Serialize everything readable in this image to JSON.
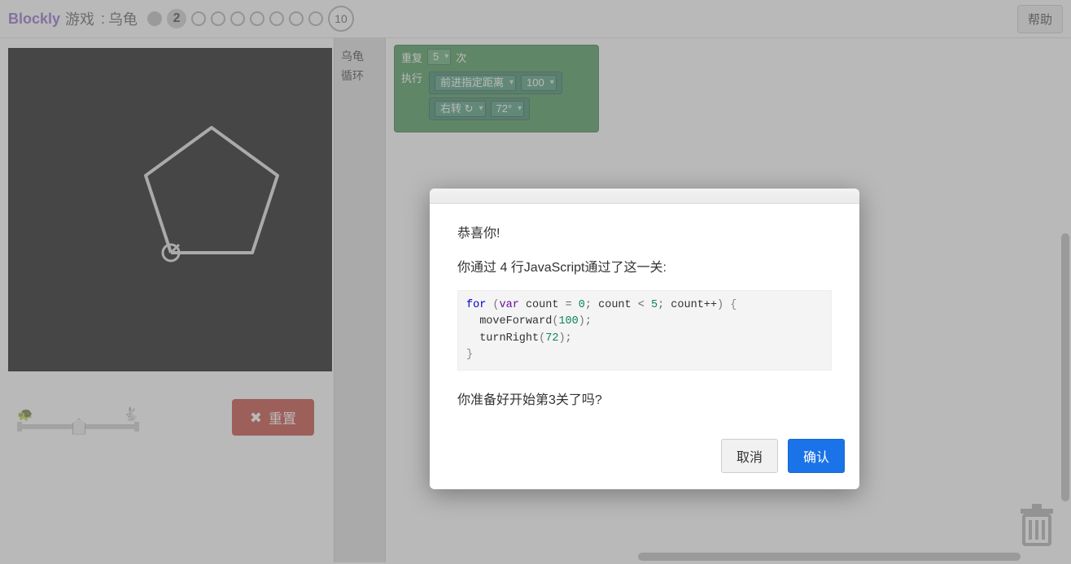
{
  "header": {
    "brand": "Blockly",
    "games_label": "游戏",
    "title_label": "乌龟",
    "levels": [
      {
        "n": "1",
        "state": "done"
      },
      {
        "n": "2",
        "state": "current"
      },
      {
        "n": "3",
        "state": "future"
      },
      {
        "n": "4",
        "state": "future"
      },
      {
        "n": "5",
        "state": "future"
      },
      {
        "n": "6",
        "state": "future"
      },
      {
        "n": "7",
        "state": "future"
      },
      {
        "n": "8",
        "state": "future"
      },
      {
        "n": "9",
        "state": "future"
      },
      {
        "n": "10",
        "state": "future-last"
      }
    ],
    "help_label": "帮助"
  },
  "controls": {
    "reset_label": "重置"
  },
  "toolbox": {
    "cat_turtle": "乌龟",
    "cat_loop": "循环"
  },
  "blocks": {
    "repeat": {
      "label_repeat": "重复",
      "times_value": "5",
      "label_times_suffix": "次",
      "label_execute": "执行"
    },
    "forward": {
      "label": "前进指定距离",
      "value": "100"
    },
    "turn": {
      "label": "右转 ↻",
      "value": "72°"
    }
  },
  "dialog": {
    "congrats": "恭喜你!",
    "summary": "你通过 4 行JavaScript通过了这一关:",
    "next_prompt": "你准备好开始第3关了吗?",
    "cancel_label": "取消",
    "ok_label": "确认",
    "code": {
      "kw_for": "for",
      "kw_var": "var",
      "ident": "count",
      "init": "0",
      "cond_op": "<",
      "cond_val": "5",
      "inc": "count++",
      "fn_move": "moveForward",
      "arg_move": "100",
      "fn_turn": "turnRight",
      "arg_turn": "72"
    }
  }
}
